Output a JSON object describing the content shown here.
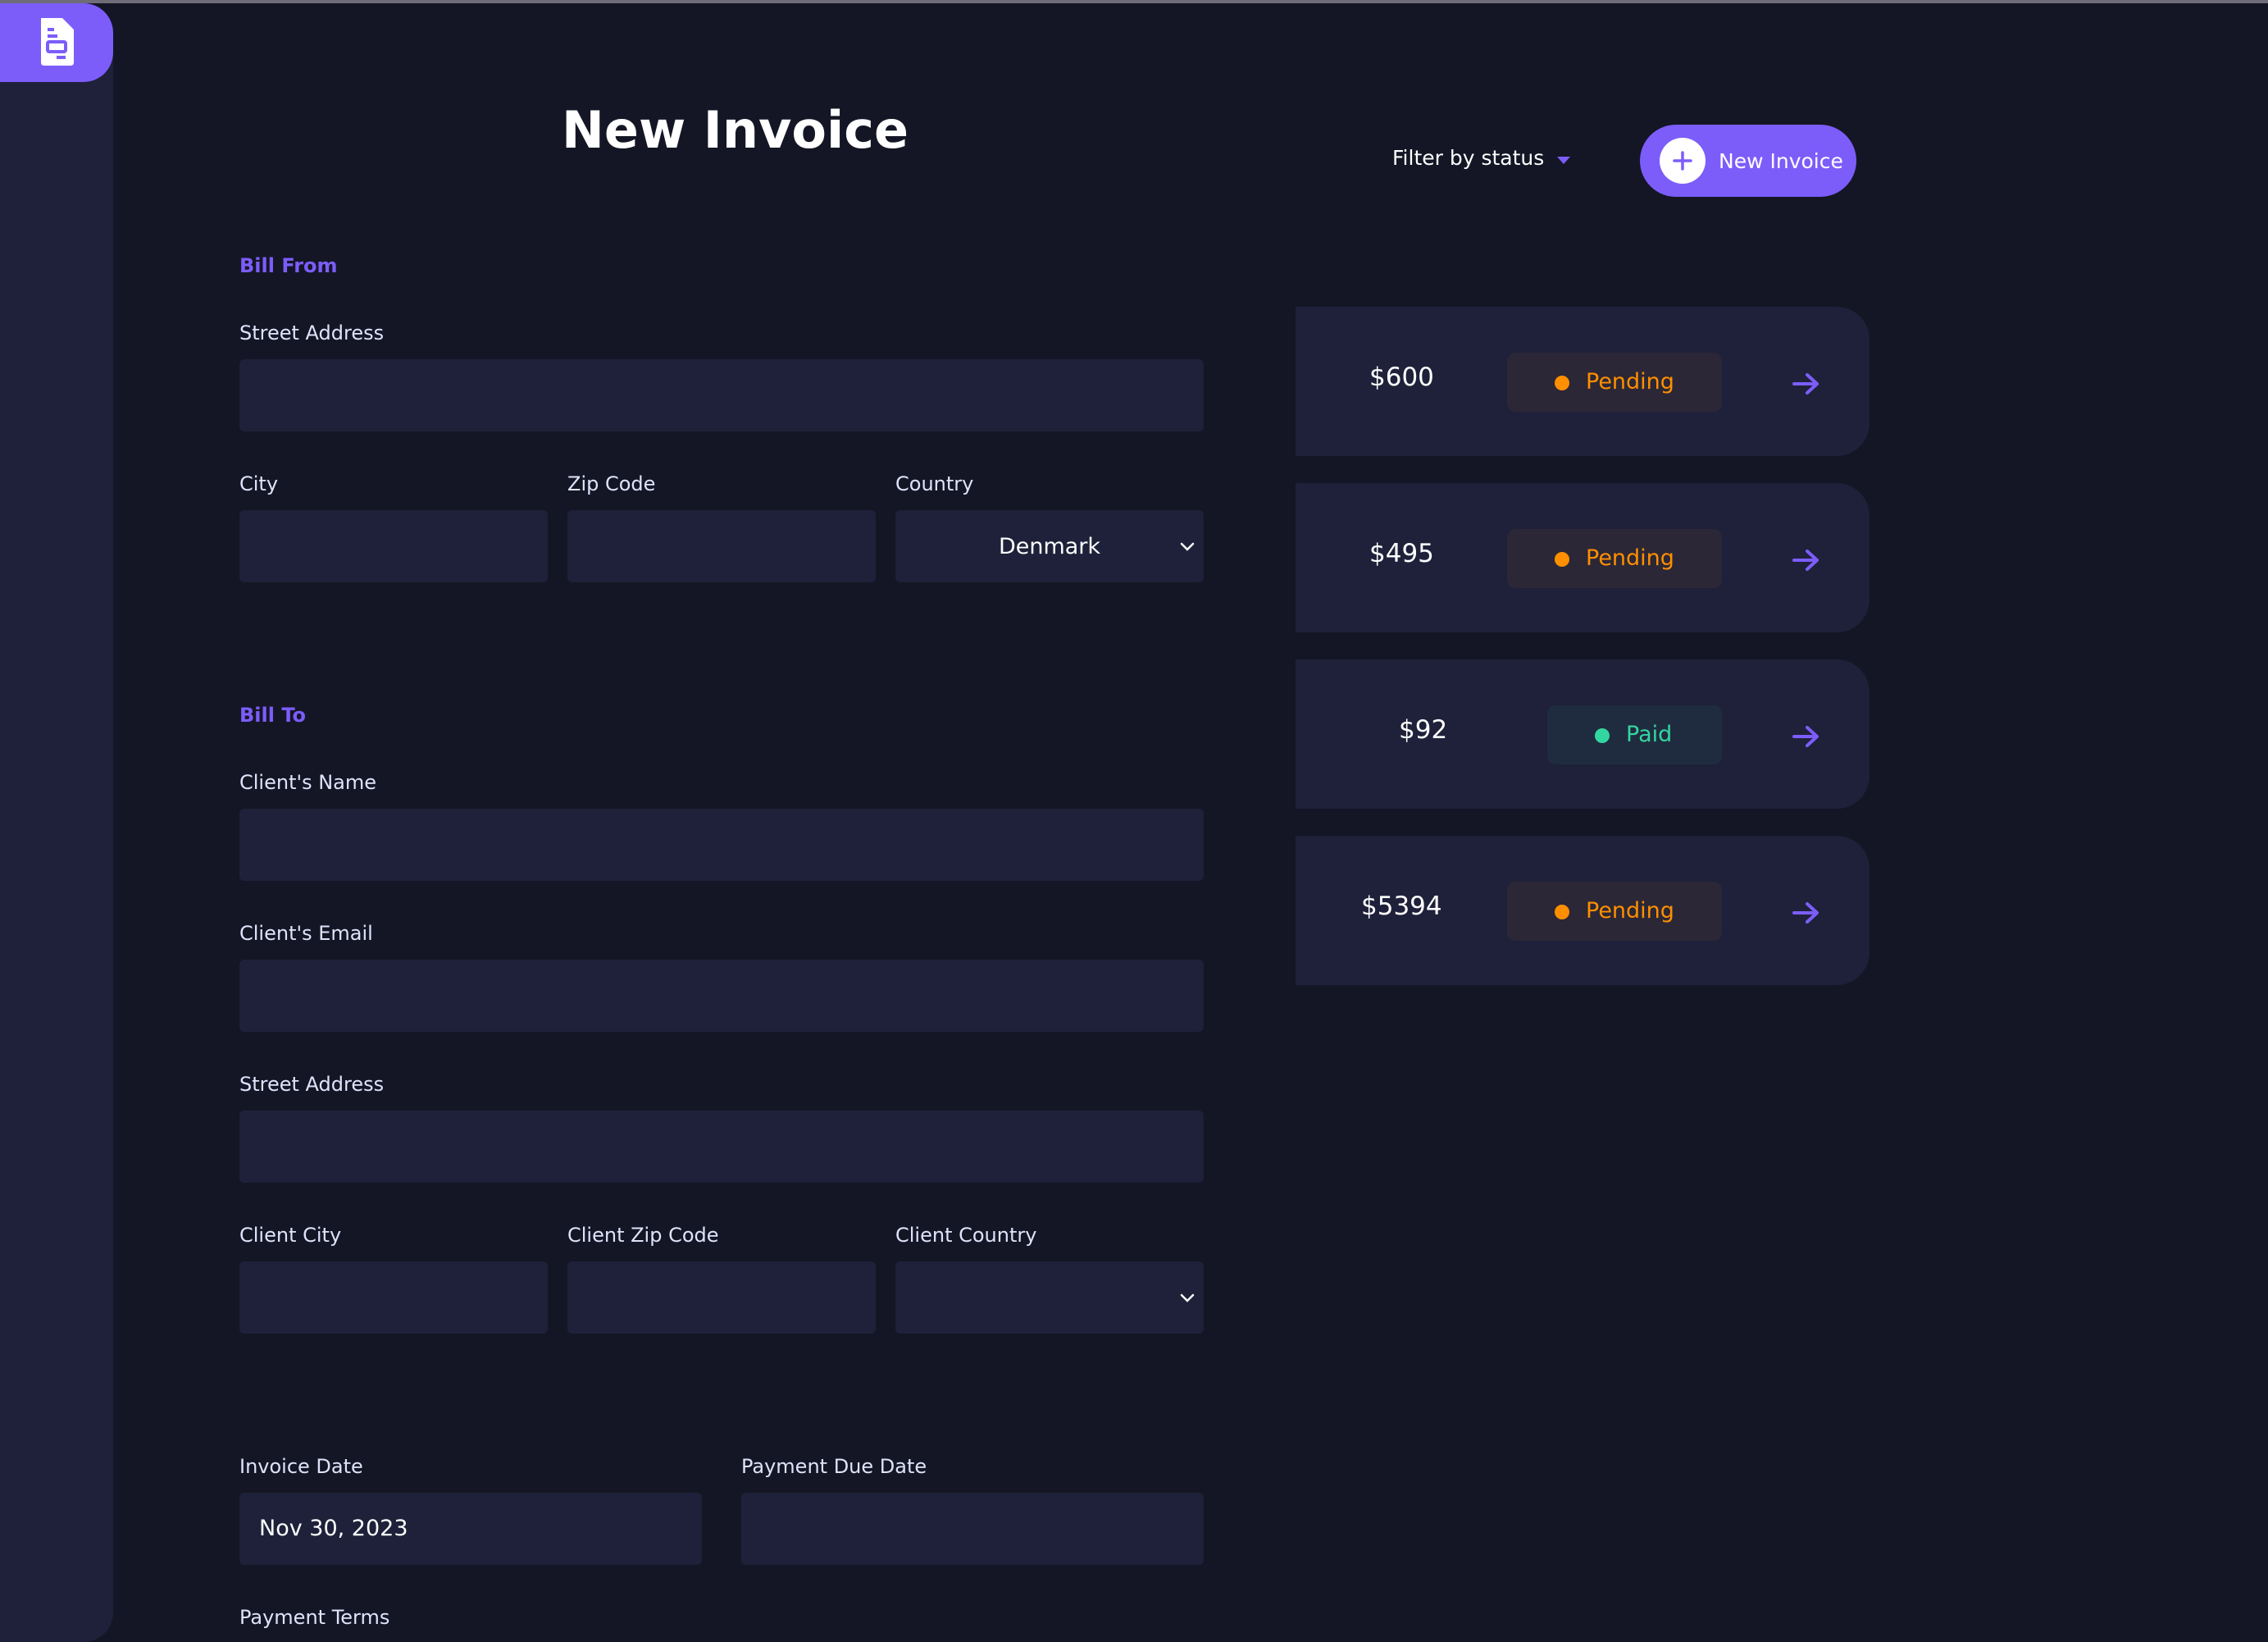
{
  "colors": {
    "background": "#141625",
    "panel": "#1e2139",
    "accent": "#7c5dfa",
    "pending": "#ff8f00",
    "paid": "#33d69f"
  },
  "sidebar": {
    "logo_icon": "invoice-document-icon"
  },
  "form": {
    "title": "New Invoice",
    "bill_from": {
      "section_label": "Bill From",
      "street_address_label": "Street Address",
      "street_address_value": "",
      "city_label": "City",
      "city_value": "",
      "zip_label": "Zip Code",
      "zip_value": "",
      "country_label": "Country",
      "country_value": "Denmark"
    },
    "bill_to": {
      "section_label": "Bill To",
      "client_name_label": "Client's Name",
      "client_name_value": "",
      "client_email_label": "Client's Email",
      "client_email_value": "",
      "street_address_label": "Street Address",
      "street_address_value": "",
      "city_label": "Client City",
      "city_value": "",
      "zip_label": "Client Zip Code",
      "zip_value": "",
      "country_label": "Client Country",
      "country_value": ""
    },
    "invoice_date_label": "Invoice Date",
    "invoice_date_value": "Nov 30, 2023",
    "payment_due_label": "Payment Due Date",
    "payment_due_value": "",
    "payment_terms_label": "Payment Terms"
  },
  "header": {
    "filter_label": "Filter by status",
    "new_invoice_label": "New Invoice"
  },
  "invoices": [
    {
      "amount": "$600",
      "status": "Pending"
    },
    {
      "amount": "$495",
      "status": "Pending"
    },
    {
      "amount": "$92",
      "status": "Paid"
    },
    {
      "amount": "$5394",
      "status": "Pending"
    }
  ]
}
